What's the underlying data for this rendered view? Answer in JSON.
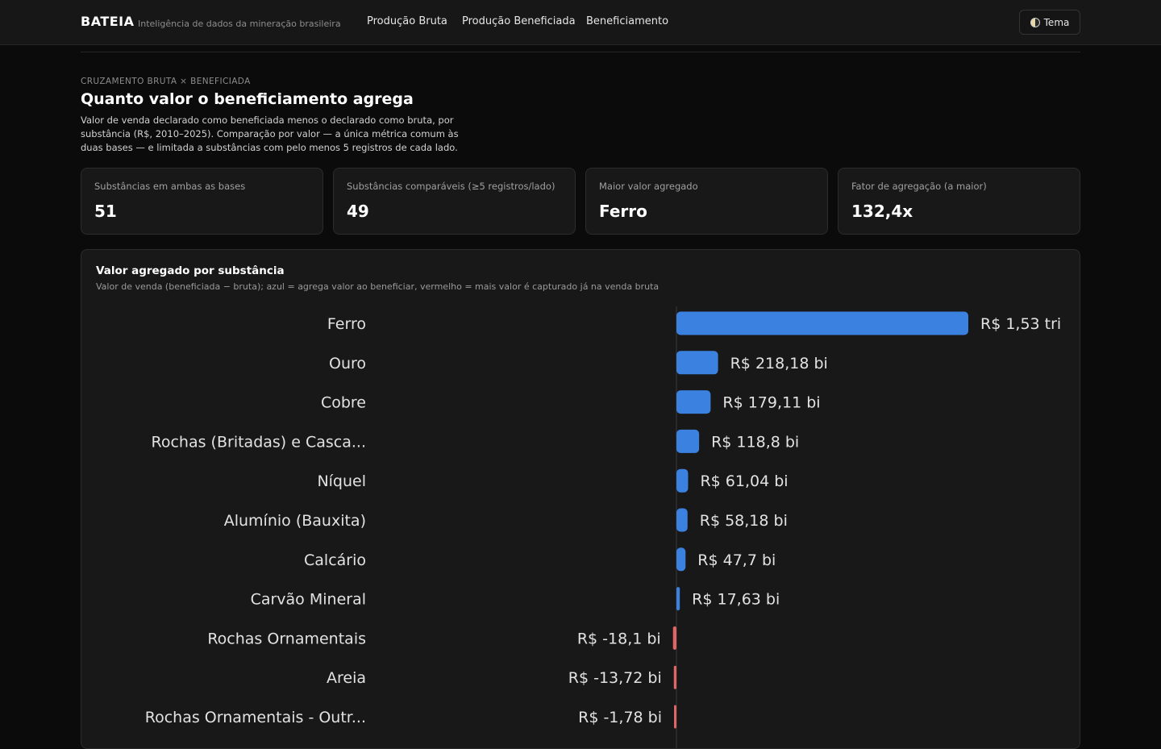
{
  "header": {
    "brand": "BATEIA",
    "tagline": "Inteligência de dados da mineração brasileira",
    "nav": [
      "Produção Bruta",
      "Produção Beneficiada",
      "Beneficiamento"
    ],
    "theme_label": "Tema"
  },
  "section": {
    "eyebrow": "CRUZAMENTO BRUTA × BENEFICIADA",
    "title": "Quanto valor o beneficiamento agrega",
    "description": "Valor de venda declarado como beneficiada menos o declarado como bruta, por substância (R$, 2010–2025). Comparação por valor — a única métrica comum às duas bases — e limitada a substâncias com pelo menos 5 registros de cada lado."
  },
  "kpis": [
    {
      "label": "Substâncias em ambas as bases",
      "value": "51"
    },
    {
      "label": "Substâncias comparáveis (≥5 registros/lado)",
      "value": "49"
    },
    {
      "label": "Maior valor agregado",
      "value": "Ferro"
    },
    {
      "label": "Fator de agregação (a maior)",
      "value": "132,4x"
    }
  ],
  "chart": {
    "title": "Valor agregado por substância",
    "subtitle": "Valor de venda (beneficiada − bruta); azul = agrega valor ao beneficiar, vermelho = mais valor é capturado já na venda bruta"
  },
  "colors": {
    "positive": "#3b82e0",
    "negative": "#e06666"
  },
  "chart_data": {
    "type": "bar",
    "orientation": "horizontal",
    "unit": "R$ bi",
    "categories": [
      "Ferro",
      "Ouro",
      "Cobre",
      "Rochas (Britadas) e Casca...",
      "Níquel",
      "Alumínio (Bauxita)",
      "Calcário",
      "Carvão Mineral",
      "Rochas Ornamentais",
      "Areia",
      "Rochas Ornamentais - Outr..."
    ],
    "values": [
      1530,
      218.18,
      179.11,
      118.8,
      61.04,
      58.18,
      47.7,
      17.63,
      -18.1,
      -13.72,
      -1.78
    ],
    "value_labels": [
      "R$ 1,53 tri",
      "R$ 218,18 bi",
      "R$ 179,11 bi",
      "R$ 118,8 bi",
      "R$ 61,04 bi",
      "R$ 58,18 bi",
      "R$ 47,7 bi",
      "R$ 17,63 bi",
      "R$ -18,1 bi",
      "R$ -13,72 bi",
      "R$ -1,78 bi"
    ],
    "xlim": [
      -1530,
      1530
    ]
  }
}
